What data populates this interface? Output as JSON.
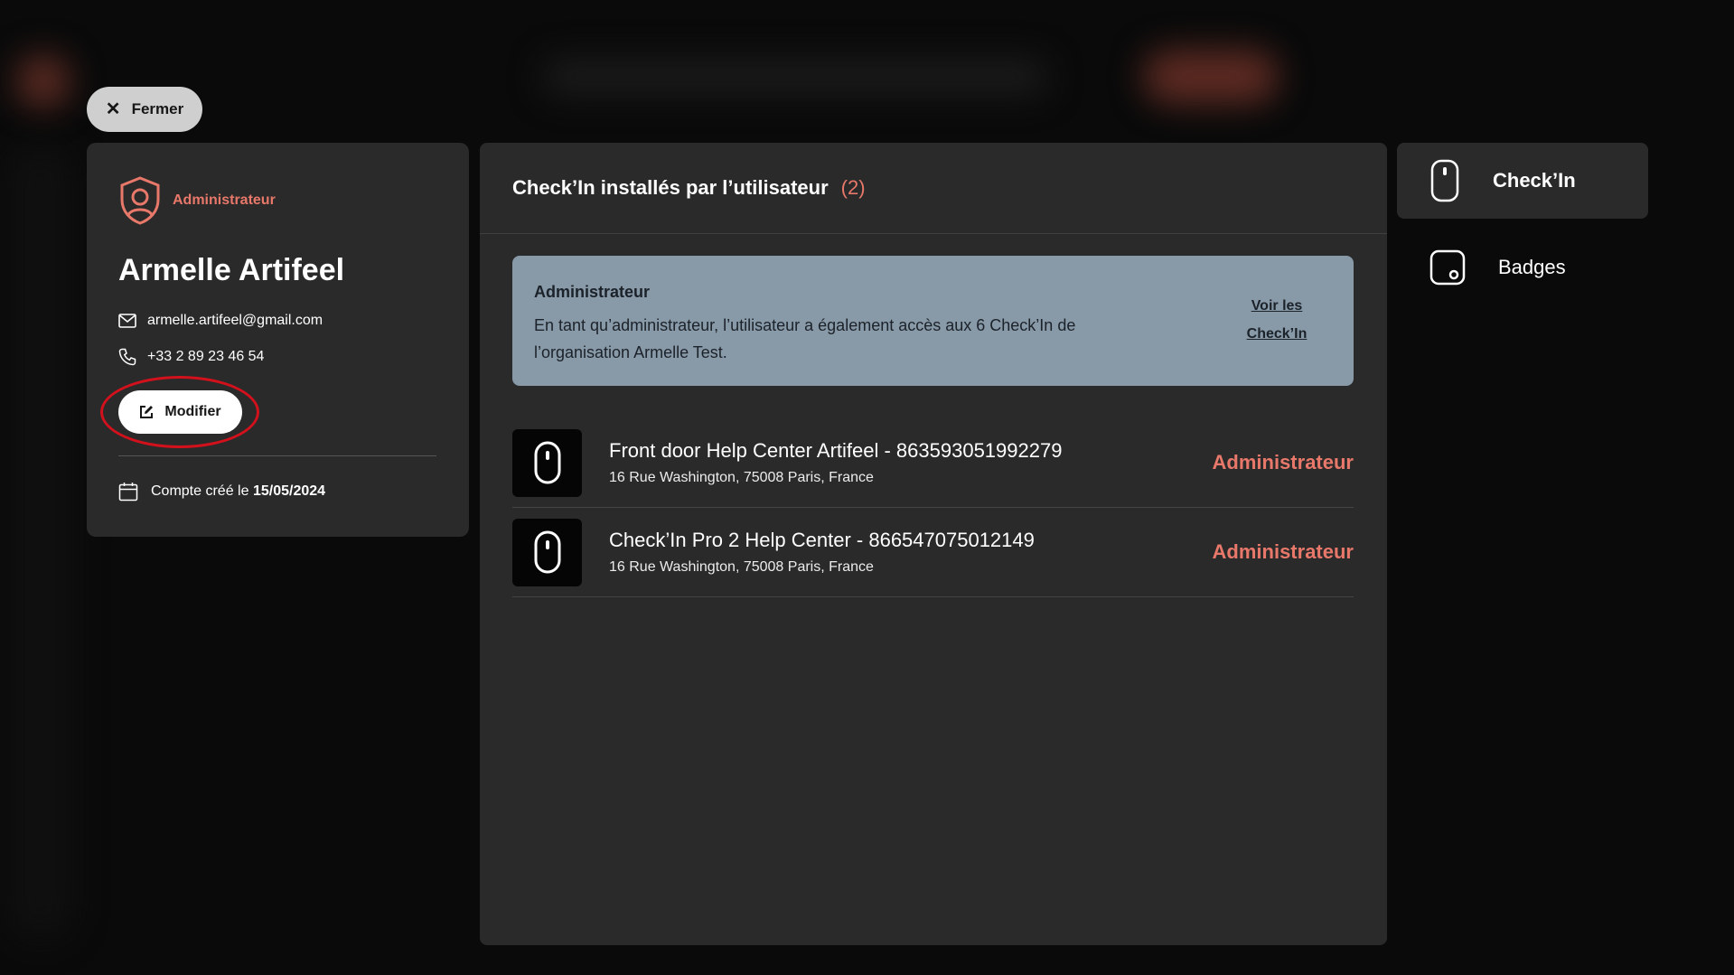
{
  "colors": {
    "accent": "#e8786a",
    "panel": "#2a2a2a",
    "info_bg": "#8899a8",
    "highlight": "#d3111c"
  },
  "close_button": {
    "label": "Fermer",
    "icon": "close-icon"
  },
  "profile": {
    "role": "Administrateur",
    "name": "Armelle Artifeel",
    "email": "armelle.artifeel@gmail.com",
    "phone": "+33 2 89 23 46 54",
    "edit_label": "Modifier",
    "created_prefix": "Compte créé le",
    "created_date": "15/05/2024"
  },
  "main": {
    "title": "Check’In installés par l’utilisateur",
    "count": "(2)",
    "info": {
      "title": "Administrateur",
      "text": "En tant qu’administrateur, l’utilisateur a également accès aux 6 Check’In de l’organisation Armelle Test.",
      "link_line1": "Voir les",
      "link_line2": "Check’In"
    },
    "devices": [
      {
        "name": "Front door Help Center Artifeel - 863593051992279",
        "address": "16 Rue Washington, 75008 Paris, France",
        "role": "Administrateur"
      },
      {
        "name": "Check’In Pro 2 Help Center - 866547075012149",
        "address": "16 Rue Washington, 75008 Paris, France",
        "role": "Administrateur"
      }
    ]
  },
  "nav": {
    "items": [
      {
        "label": "Check’In",
        "icon": "checkin-device-icon",
        "active": true
      },
      {
        "label": "Badges",
        "icon": "badge-icon",
        "active": false
      }
    ]
  }
}
